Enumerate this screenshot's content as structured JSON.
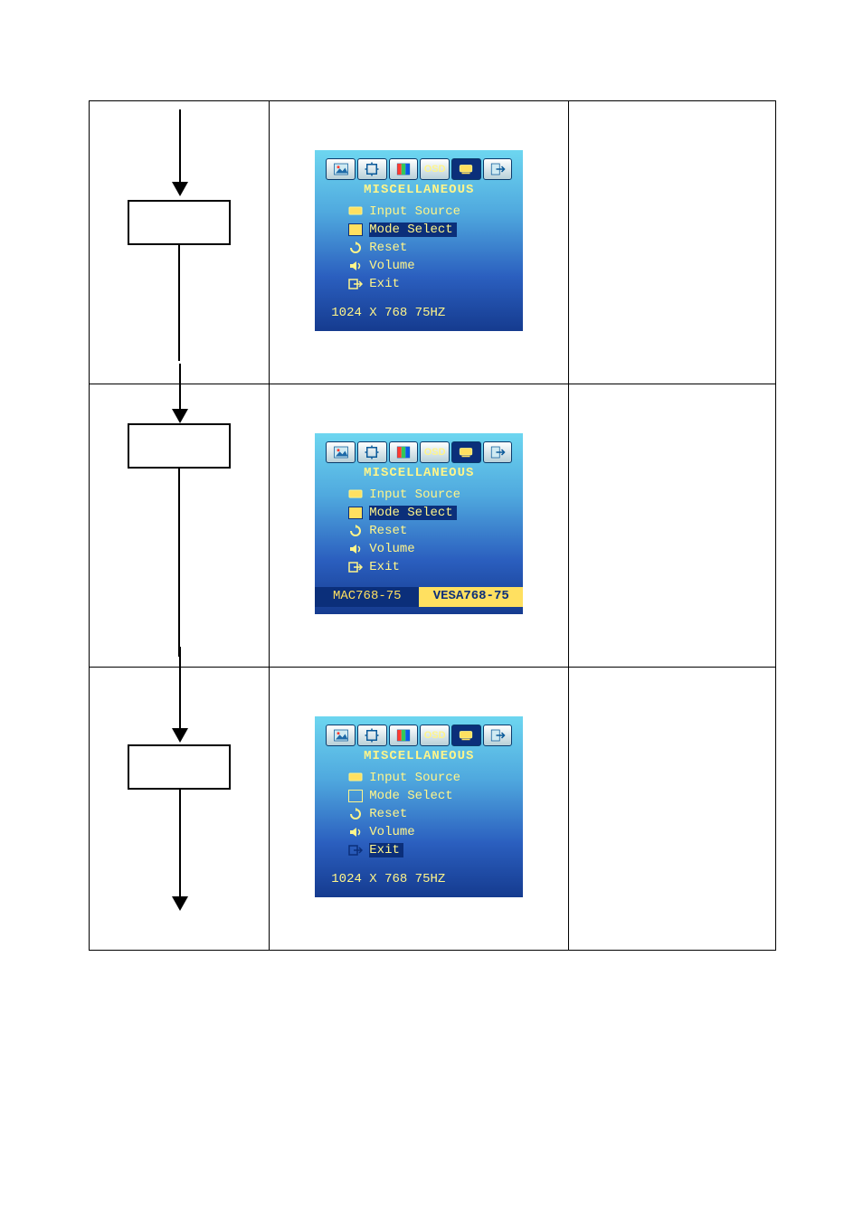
{
  "osd": {
    "section_title": "MISCELLANEOUS",
    "items": {
      "input_source": "Input Source",
      "mode_select": "Mode Select",
      "reset": "Reset",
      "volume": "Volume",
      "exit": "Exit"
    },
    "resolution_status": "1024 X 768 75HZ",
    "mode_status_left": "MAC768-75",
    "mode_status_right": "VESA768-75",
    "tab_icons": [
      "picture-icon",
      "geometry-icon",
      "color-icon",
      "osd-icon",
      "misc-icon",
      "exit-icon"
    ],
    "tab_osd_label": "OSD"
  },
  "panels": [
    {
      "highlight": "mode_select",
      "status_variant": "resolution"
    },
    {
      "highlight": "mode_select",
      "status_variant": "mode_pair"
    },
    {
      "highlight": "exit",
      "status_variant": "resolution"
    }
  ]
}
